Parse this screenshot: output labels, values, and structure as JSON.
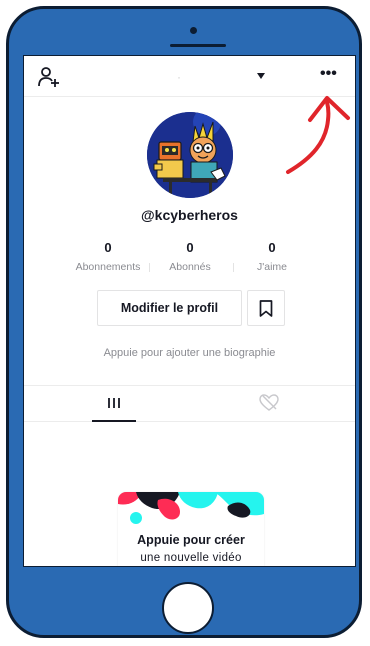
{
  "header": {
    "username": "·",
    "add_friend_icon": "add-user-icon",
    "dropdown_icon": "caret-down-icon",
    "more_label": "•••"
  },
  "profile": {
    "handle": "@kcyberheros",
    "stats": [
      {
        "value": "0",
        "label": "Abonnements"
      },
      {
        "value": "0",
        "label": "Abonnés"
      },
      {
        "value": "0",
        "label": "J'aime"
      }
    ],
    "edit_label": "Modifier le profil",
    "bookmark_icon": "bookmark-icon",
    "bio_placeholder": "Appuie pour ajouter une biographie"
  },
  "tabs": [
    {
      "icon": "grid-icon",
      "active": true
    },
    {
      "icon": "liked-heart-icon",
      "active": false
    }
  ],
  "create_card": {
    "title": "Appuie pour créer",
    "subtitle": "une nouvelle vidéo"
  },
  "colors": {
    "phone_frame": "#2a6ab3",
    "phone_outline": "#0c1d33",
    "text_primary": "#161823",
    "text_secondary": "#8a8b91",
    "annotation": "#e0252b",
    "accent_pink": "#fe2c55",
    "accent_cyan": "#25f4ee"
  }
}
